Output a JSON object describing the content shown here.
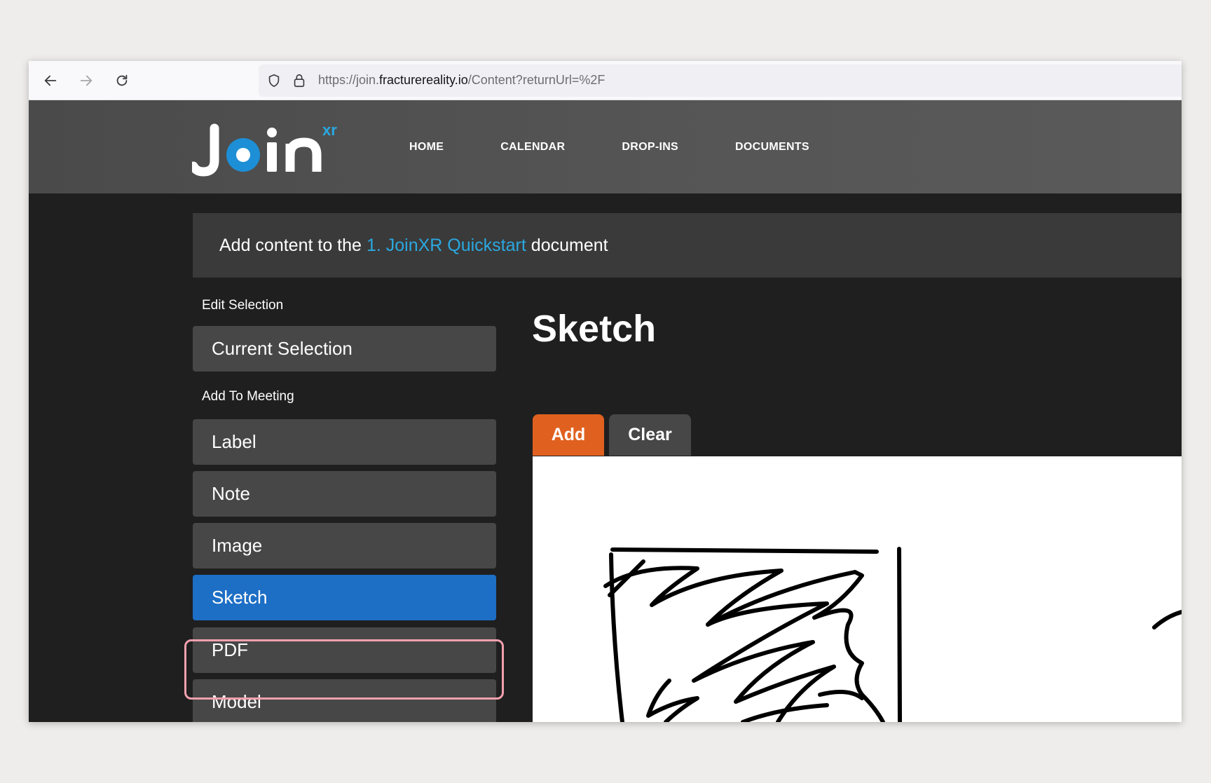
{
  "browser": {
    "url_prefix": "https://join.",
    "url_host": "fracturereality.io",
    "url_path": "/Content?returnUrl=%2F"
  },
  "site": {
    "logo_text": "Join",
    "logo_superscript": "XR",
    "nav": [
      "HOME",
      "CALENDAR",
      "DROP-INS",
      "DOCUMENTS"
    ]
  },
  "banner": {
    "prefix": "Add content to the",
    "document_link": "1. JoinXR Quickstart",
    "suffix": "document"
  },
  "sidebar": {
    "edit_section_label": "Edit Selection",
    "current_selection": "Current Selection",
    "add_section_label": "Add To Meeting",
    "items": [
      "Label",
      "Note",
      "Image",
      "Sketch",
      "PDF",
      "Model"
    ],
    "active_item": "Sketch"
  },
  "panel": {
    "title": "Sketch",
    "add_label": "Add",
    "clear_label": "Clear"
  },
  "colors": {
    "accent_blue": "#1d6ec5",
    "add_orange": "#e0611f",
    "link_blue": "#2aa8e0",
    "highlight_pink": "#f2a0ad"
  }
}
